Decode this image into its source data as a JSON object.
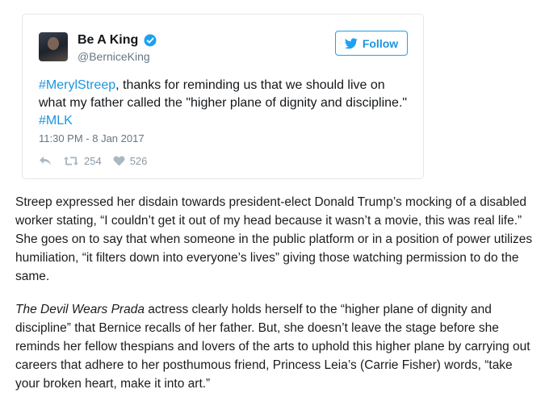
{
  "tweet": {
    "display_name": "Be A King",
    "handle": "@BerniceKing",
    "follow_label": "Follow",
    "text": {
      "hashtag1": "#MerylStreep",
      "body": ", thanks for reminding us that we should live on what my father called the \"higher plane of dignity and discipline.\"",
      "hashtag2": "#MLK"
    },
    "timestamp": "11:30 PM - 8 Jan 2017",
    "retweets": "254",
    "likes": "526",
    "colors": {
      "accent": "#1da1f2",
      "link": "#1b95e0",
      "muted": "#657786"
    }
  },
  "article": {
    "paragraph1": "Streep expressed her disdain towards president-elect Donald Trump’s mocking of a disabled worker stating, “I couldn’t get it out of my head because it wasn’t a movie, this was real life.” She goes on to say that when someone in the public platform or in a position of power utilizes humiliation, “it filters down into everyone’s lives” giving those watching permission to do the same.",
    "paragraph2_title": "The Devil Wears Prada",
    "paragraph2_rest": " actress clearly holds herself to the “higher plane of dignity and discipline” that Bernice recalls of her father. But, she doesn’t leave the stage before she reminds her fellow thespians and lovers of the arts to uphold this higher plane by carrying out careers that adhere to her posthumous friend, Princess Leia’s (Carrie Fisher) words, “take your broken heart, make it into art.”"
  },
  "icons": [
    "verified-icon",
    "twitter-bird-icon",
    "reply-icon",
    "retweet-icon",
    "heart-icon"
  ]
}
